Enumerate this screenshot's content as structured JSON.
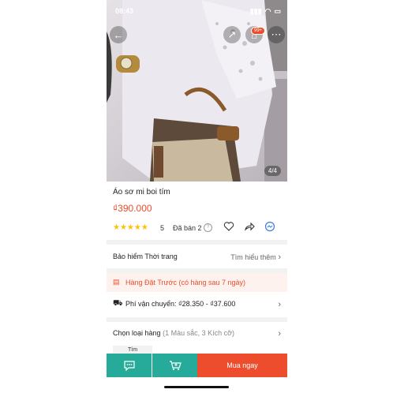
{
  "status_bar": {
    "time": "08:43"
  },
  "hero": {
    "cart_badge": "99+",
    "image_counter": "4/4"
  },
  "product": {
    "title": "Áo sơ mi boi tím",
    "price": "₫390.000",
    "rating": "5",
    "sold": "Đã bán 2"
  },
  "insurance": {
    "label": "Bảo hiểm Thời trang",
    "action": "Tìm hiểu thêm"
  },
  "preorder": {
    "text": "Hàng Đặt Trước (có hàng sau 7 ngày)"
  },
  "shipping": {
    "text": "Phí vận chuyển: ₫28.350 - ₫37.600"
  },
  "variants": {
    "label": "Chọn loại hàng",
    "detail": "(1 Màu sắc, 3 Kích cỡ)",
    "chip": "Tím"
  },
  "bottom": {
    "buy_label": "Mua ngay"
  },
  "colors": {
    "accent": "#ee4d2d",
    "teal": "#26aa99",
    "star": "#ffc107"
  }
}
